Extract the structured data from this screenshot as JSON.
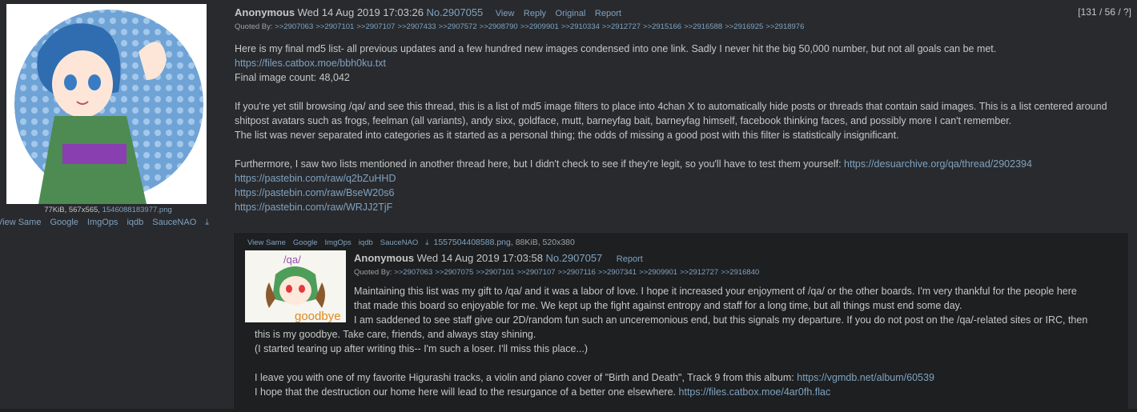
{
  "op": {
    "file_info": "77KiB, 567x565,",
    "file_name": "1546088183977.png",
    "search_links": [
      "View Same",
      "Google",
      "ImgOps",
      "iqdb",
      "SauceNAO"
    ],
    "name": "Anonymous",
    "date": "Wed 14 Aug 2019 17:03:26",
    "number": "No.2907055",
    "actions": [
      "View",
      "Reply",
      "Original",
      "Report"
    ],
    "quoted_by_label": "Quoted By:",
    "quoted_by": [
      ">>2907063",
      ">>2907101",
      ">>2907107",
      ">>2907433",
      ">>2907572",
      ">>2908790",
      ">>2909901",
      ">>2910334",
      ">>2912727",
      ">>2915166",
      ">>2916588",
      ">>2916925",
      ">>2918976"
    ],
    "body": {
      "p1": "Here is my final md5 list- all previous updates and a few hundred new images condensed into one link. Sadly I never hit the big 50,000 number, but not all goals can be met.",
      "link1": "https://files.catbox.moe/bbh0ku.txt",
      "count": "Final image count: 48,042",
      "p2": "If you're yet still browsing /qa/ and see this thread, this is a list of md5 image filters to place into 4chan X to automatically hide posts or threads that contain said images. This is a list centered around shitpost avatars such as frogs, feelman (all variants), andy sixx, goldface, mutt, barneyfag bait, barneyfag himself, facebook thinking faces, and possibly more I can't remember.",
      "p3": "The list was never separated into categories as it started as a personal thing; the odds of missing a good post with this filter is statistically insignificant.",
      "p4": "Furthermore, I saw two lists mentioned in another thread here, but I didn't check to see if they're legit, so you'll have to test them yourself:",
      "link2": "https://desuarchive.org/qa/thread/2902394",
      "link3": "https://pastebin.com/raw/q2bZuHHD",
      "link4": "https://pastebin.com/raw/BseW20s6",
      "link5": "https://pastebin.com/raw/WRJJ2TjF"
    }
  },
  "counter": "[131 / 56 / ?]",
  "reply": {
    "search_links": [
      "View Same",
      "Google",
      "ImgOps",
      "iqdb",
      "SauceNAO"
    ],
    "file_name": "1557504408588.png",
    "file_info": ", 88KiB, 520x380",
    "thumb_text_top": "/qa/",
    "thumb_text_bottom": "goodbye",
    "name": "Anonymous",
    "date": "Wed 14 Aug 2019 17:03:58",
    "number": "No.2907057",
    "report": "Report",
    "quoted_by_label": "Quoted By:",
    "quoted_by": [
      ">>2907063",
      ">>2907075",
      ">>2907101",
      ">>2907107",
      ">>2907116",
      ">>2907341",
      ">>2909901",
      ">>2912727",
      ">>2916840"
    ],
    "body": {
      "l1": "Maintaining this list was my gift to /qa/ and it was a labor of love. I hope it increased your enjoyment of /qa/ or the other boards. I'm very thankful for the people here",
      "l2": "that made this board so enjoyable for me. We kept up the fight against entropy and staff for a long time, but all things must end some day.",
      "l3": "I am saddened to see staff give our 2D/random fun such an unceremonious end, but this signals my departure. If you do not post on the /qa/-related sites or IRC, then",
      "l4": "this is my goodbye. Take care, friends, and always stay shining.",
      "l5": "(I started tearing up after writing this-- I'm such a loser. I'll miss this place...)",
      "l6": "I leave you with one of my favorite Higurashi tracks, a violin and piano cover of \"Birth and Death\", Track 9 from this album:",
      "link1": "https://vgmdb.net/album/60539",
      "l7": "I hope that the destruction our home here will lead to the resurgance of a better one elsewhere.",
      "link2": "https://files.catbox.moe/4ar0fh.flac"
    }
  },
  "colors": {
    "background": "#282a2e",
    "reply_bg": "#1d1f21",
    "link": "#81a2be",
    "text": "#c5c8c6"
  },
  "icons": {
    "download": "download-icon"
  }
}
